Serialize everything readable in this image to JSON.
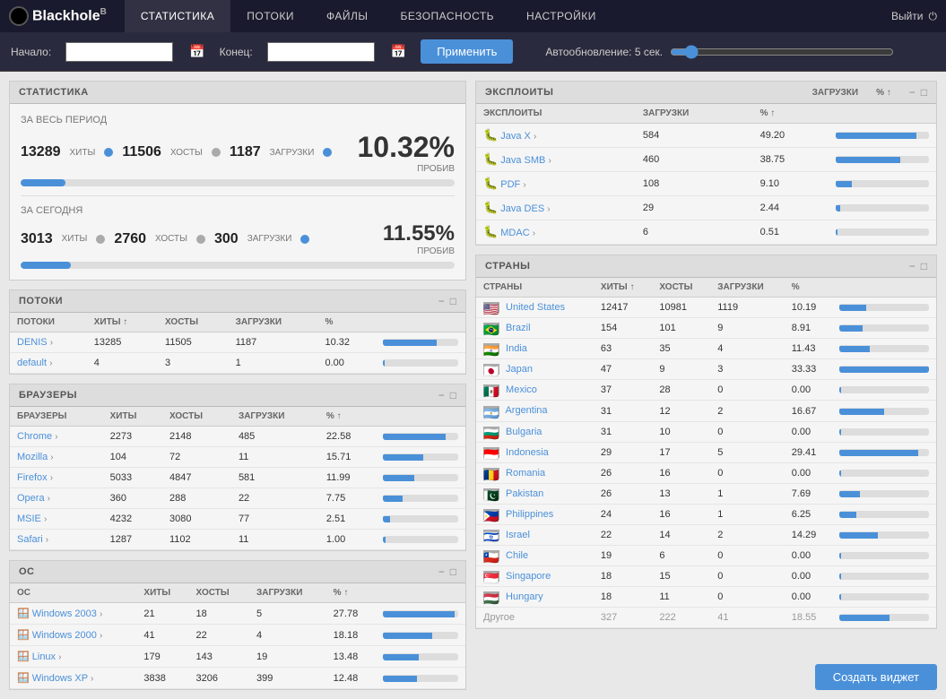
{
  "app": {
    "logo": "Blackhole",
    "logo_sup": "B"
  },
  "nav": {
    "items": [
      "СТАТИСТИКА",
      "ПОТОКИ",
      "ФАЙЛЫ",
      "БЕЗОПАСНОСТЬ",
      "НАСТРОЙКИ"
    ],
    "active": 0,
    "logout": "Выйти"
  },
  "toolbar": {
    "start_label": "Начало:",
    "end_label": "Конец:",
    "apply_button": "Применить",
    "autoupdate_label": "Автообновление: 5 сек."
  },
  "stats": {
    "title": "СТАТИСТИКА",
    "period_label": "ЗА ВЕСЬ ПЕРИОД",
    "hits_count": "13289",
    "hits_label": "ХИТЫ",
    "hosts_count": "11506",
    "hosts_label": "ХОСТЫ",
    "downloads_count": "1187",
    "downloads_label": "ЗАГРУЗКИ",
    "percent": "10.32%",
    "pct_label": "ПРОБИВ",
    "progress_pct": 10.32,
    "today_label": "ЗА СЕГОДНЯ",
    "today_hits": "3013",
    "today_hits_label": "ХИТЫ",
    "today_hosts": "2760",
    "today_hosts_label": "ХОСТЫ",
    "today_downloads": "300",
    "today_downloads_label": "ЗАГРУЗКИ",
    "today_percent": "11.55%",
    "today_pct_label": "ПРОБИВ",
    "today_progress_pct": 11.55
  },
  "streams": {
    "title": "ПОТОКИ",
    "columns": [
      "ПОТОКИ",
      "ХИТЫ ↑",
      "ХОСТЫ",
      "ЗАГРУЗКИ",
      "%",
      "",
      ""
    ],
    "rows": [
      {
        "name": "DENIS",
        "hits": "13285",
        "hosts": "11505",
        "downloads": "1187",
        "pct": "10.32",
        "bar_pct": 60
      },
      {
        "name": "default",
        "hits": "4",
        "hosts": "3",
        "downloads": "1",
        "pct": "0.00",
        "bar_pct": 0
      }
    ]
  },
  "browsers": {
    "title": "БРАУЗЕРЫ",
    "columns": [
      "БРАУЗЕРЫ",
      "ХИТЫ",
      "ХОСТЫ",
      "ЗАГРУЗКИ",
      "% ↑",
      "",
      ""
    ],
    "rows": [
      {
        "name": "Chrome",
        "hits": "2273",
        "hosts": "2148",
        "downloads": "485",
        "pct": "22.58",
        "bar_pct": 70
      },
      {
        "name": "Mozilla",
        "hits": "104",
        "hosts": "72",
        "downloads": "11",
        "pct": "15.71",
        "bar_pct": 45
      },
      {
        "name": "Firefox",
        "hits": "5033",
        "hosts": "4847",
        "downloads": "581",
        "pct": "11.99",
        "bar_pct": 35
      },
      {
        "name": "Opera",
        "hits": "360",
        "hosts": "288",
        "downloads": "22",
        "pct": "7.75",
        "bar_pct": 22
      },
      {
        "name": "MSIE",
        "hits": "4232",
        "hosts": "3080",
        "downloads": "77",
        "pct": "2.51",
        "bar_pct": 8
      },
      {
        "name": "Safari",
        "hits": "1287",
        "hosts": "1102",
        "downloads": "11",
        "pct": "1.00",
        "bar_pct": 3
      }
    ]
  },
  "os": {
    "title": "ОС",
    "columns": [
      "ОС",
      "ХИТЫ",
      "ХОСТЫ",
      "ЗАГРУЗКИ",
      "% ↑",
      "",
      ""
    ],
    "rows": [
      {
        "name": "Windows 2003",
        "hits": "21",
        "hosts": "18",
        "downloads": "5",
        "pct": "27.78",
        "bar_pct": 80
      },
      {
        "name": "Windows 2000",
        "hits": "41",
        "hosts": "22",
        "downloads": "4",
        "pct": "18.18",
        "bar_pct": 55
      },
      {
        "name": "Linux",
        "hits": "179",
        "hosts": "143",
        "downloads": "19",
        "pct": "13.48",
        "bar_pct": 40
      },
      {
        "name": "Windows XP",
        "hits": "3838",
        "hosts": "3206",
        "downloads": "399",
        "pct": "12.48",
        "bar_pct": 38
      }
    ]
  },
  "exploits": {
    "title": "ЭКСПЛОИТЫ",
    "columns": [
      "ЭКСПЛОИТЫ",
      "ЗАГРУЗКИ",
      "% ↑",
      "",
      ""
    ],
    "rows": [
      {
        "name": "Java X",
        "downloads": "584",
        "pct": "49.20",
        "bar_pct": 75
      },
      {
        "name": "Java SMB",
        "downloads": "460",
        "pct": "38.75",
        "bar_pct": 60
      },
      {
        "name": "PDF",
        "downloads": "108",
        "pct": "9.10",
        "bar_pct": 15
      },
      {
        "name": "Java DES",
        "downloads": "29",
        "pct": "2.44",
        "bar_pct": 4
      },
      {
        "name": "MDAC",
        "downloads": "6",
        "pct": "0.51",
        "bar_pct": 1
      }
    ]
  },
  "countries": {
    "title": "СТРАНЫ",
    "columns": [
      "СТРАНЫ",
      "ХИТЫ ↑",
      "ХОСТЫ",
      "ЗАГРУЗКИ",
      "%",
      "",
      ""
    ],
    "rows": [
      {
        "name": "United States",
        "flag": "🇺🇸",
        "hits": "12417",
        "hosts": "10981",
        "downloads": "1119",
        "pct": "10.19",
        "bar_pct": 30
      },
      {
        "name": "Brazil",
        "flag": "🇧🇷",
        "hits": "154",
        "hosts": "101",
        "downloads": "9",
        "pct": "8.91",
        "bar_pct": 26
      },
      {
        "name": "India",
        "flag": "🇮🇳",
        "hits": "63",
        "hosts": "35",
        "downloads": "4",
        "pct": "11.43",
        "bar_pct": 34
      },
      {
        "name": "Japan",
        "flag": "🇯🇵",
        "hits": "47",
        "hosts": "9",
        "downloads": "3",
        "pct": "33.33",
        "bar_pct": 100
      },
      {
        "name": "Mexico",
        "flag": "🇲🇽",
        "hits": "37",
        "hosts": "28",
        "downloads": "0",
        "pct": "0.00",
        "bar_pct": 0
      },
      {
        "name": "Argentina",
        "flag": "🇦🇷",
        "hits": "31",
        "hosts": "12",
        "downloads": "2",
        "pct": "16.67",
        "bar_pct": 50
      },
      {
        "name": "Bulgaria",
        "flag": "🇧🇬",
        "hits": "31",
        "hosts": "10",
        "downloads": "0",
        "pct": "0.00",
        "bar_pct": 0
      },
      {
        "name": "Indonesia",
        "flag": "🇮🇩",
        "hits": "29",
        "hosts": "17",
        "downloads": "5",
        "pct": "29.41",
        "bar_pct": 88
      },
      {
        "name": "Romania",
        "flag": "🇷🇴",
        "hits": "26",
        "hosts": "16",
        "downloads": "0",
        "pct": "0.00",
        "bar_pct": 0
      },
      {
        "name": "Pakistan",
        "flag": "🇵🇰",
        "hits": "26",
        "hosts": "13",
        "downloads": "1",
        "pct": "7.69",
        "bar_pct": 23
      },
      {
        "name": "Philippines",
        "flag": "🇵🇭",
        "hits": "24",
        "hosts": "16",
        "downloads": "1",
        "pct": "6.25",
        "bar_pct": 19
      },
      {
        "name": "Israel",
        "flag": "🇮🇱",
        "hits": "22",
        "hosts": "14",
        "downloads": "2",
        "pct": "14.29",
        "bar_pct": 43
      },
      {
        "name": "Chile",
        "flag": "🇨🇱",
        "hits": "19",
        "hosts": "6",
        "downloads": "0",
        "pct": "0.00",
        "bar_pct": 0
      },
      {
        "name": "Singapore",
        "flag": "🇸🇬",
        "hits": "18",
        "hosts": "15",
        "downloads": "0",
        "pct": "0.00",
        "bar_pct": 0
      },
      {
        "name": "Hungary",
        "flag": "🇭🇺",
        "hits": "18",
        "hosts": "11",
        "downloads": "0",
        "pct": "0.00",
        "bar_pct": 0
      },
      {
        "name": "Другое",
        "flag": "",
        "hits": "327",
        "hosts": "222",
        "downloads": "41",
        "pct": "18.55",
        "bar_pct": 56,
        "gray": true
      }
    ]
  },
  "create_widget_btn": "Создать виджет"
}
